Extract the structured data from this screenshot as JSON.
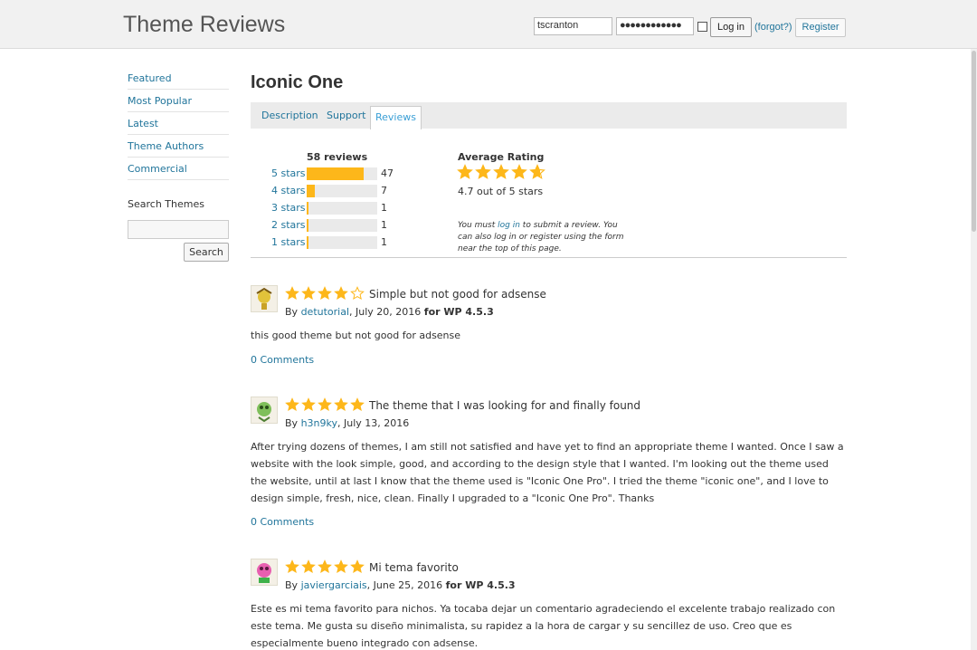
{
  "header": {
    "site_title": "Theme Reviews",
    "username_value": "tscranton",
    "password_value": "●●●●●●●●●●●●",
    "login_label": "Log in",
    "forgot_label": "(forgot?)",
    "register_label": "Register"
  },
  "sidebar": {
    "items": [
      {
        "label": "Featured"
      },
      {
        "label": "Most Popular"
      },
      {
        "label": "Latest"
      },
      {
        "label": "Theme Authors"
      },
      {
        "label": "Commercial"
      }
    ],
    "search_title": "Search Themes",
    "search_button": "Search"
  },
  "theme": {
    "title": "Iconic One",
    "tabs": [
      {
        "label": "Description"
      },
      {
        "label": "Support"
      },
      {
        "label": "Reviews",
        "active": true
      }
    ]
  },
  "ratings": {
    "total_label": "58 reviews",
    "rows": [
      {
        "label": "5 stars",
        "count": "47",
        "fraction": 0.81
      },
      {
        "label": "4 stars",
        "count": "7",
        "fraction": 0.12
      },
      {
        "label": "3 stars",
        "count": "1",
        "fraction": 0.02
      },
      {
        "label": "2 stars",
        "count": "1",
        "fraction": 0.02
      },
      {
        "label": "1 stars",
        "count": "1",
        "fraction": 0.02
      }
    ],
    "average_title": "Average Rating",
    "average_value": 4.7,
    "average_text": "4.7 out of 5 stars",
    "note_prefix": "You must ",
    "note_link": "log in",
    "note_suffix": " to submit a review. You can also log in or register using the form near the top of this page."
  },
  "reviews": [
    {
      "stars": 4,
      "title": "Simple but not good for adsense",
      "by_prefix": "By ",
      "author": "detutorial",
      "date": ", July 20, 2016 ",
      "version": "for WP 4.5.3",
      "body": "this good theme but not good for adsense",
      "comments": "0 Comments"
    },
    {
      "stars": 5,
      "title": "The theme that I was looking for and finally found",
      "by_prefix": "By ",
      "author": "h3n9ky",
      "date": ", July 13, 2016",
      "version": "",
      "body": "After trying dozens of themes, I am still not satisfied and have yet to find an appropriate theme I wanted. Once I saw a website with the look simple, good, and according to the design style that I wanted. I'm looking out the theme used the website, until at last I know that the theme used is \"Iconic One Pro\". I tried the theme \"iconic one\", and I love to design simple, fresh, nice, clean. Finally I upgraded to a \"Iconic One Pro\". Thanks",
      "comments": "0 Comments"
    },
    {
      "stars": 5,
      "title": "Mi tema favorito",
      "by_prefix": "By ",
      "author": "javiergarciais",
      "date": ", June 25, 2016 ",
      "version": "for WP 4.5.3",
      "body": "Este es mi tema favorito para nichos. Ya tocaba dejar un comentario agradeciendo el excelente trabajo realizado con este tema. Me gusta su diseño minimalista, su rapidez a la hora de cargar y su sencillez de uso. Creo que es especialmente bueno integrado con adsense.",
      "comments": ""
    }
  ],
  "colors": {
    "star": "#fdb71a",
    "link": "#21759b"
  }
}
